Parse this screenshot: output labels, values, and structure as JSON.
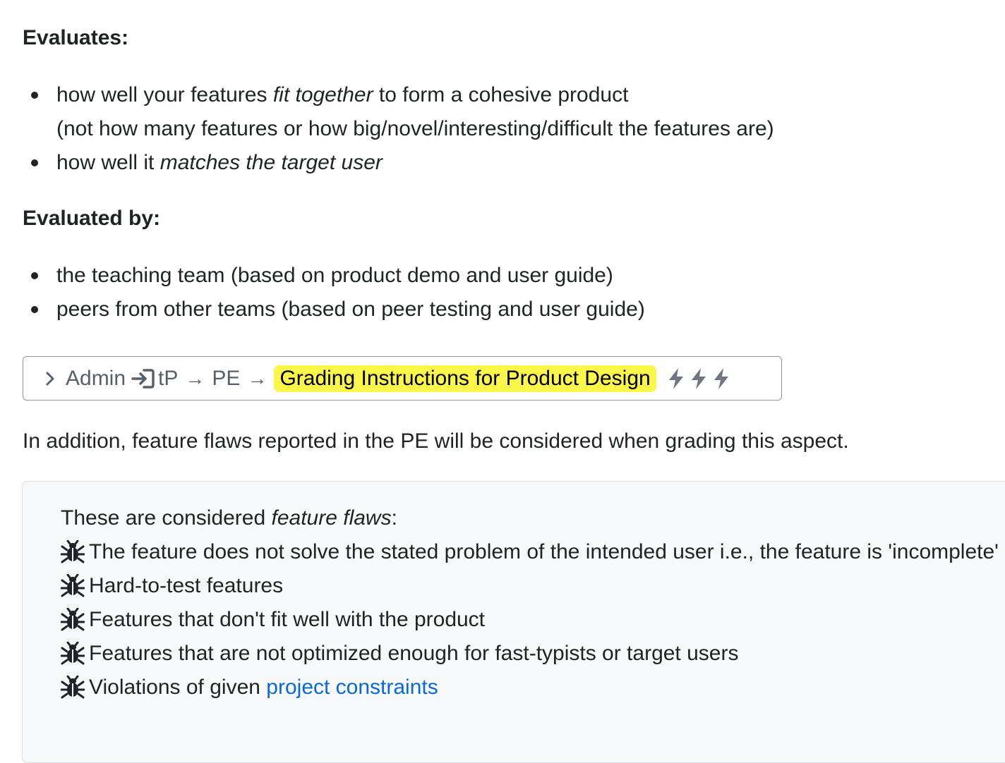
{
  "sections": {
    "evaluates": {
      "heading": "Evaluates:",
      "item1": {
        "pre": "how well your features ",
        "em": "fit together",
        "post": " to form a cohesive product",
        "line2": "(not how many features or how big/novel/interesting/difficult the features are)"
      },
      "item2": {
        "pre": "how well it ",
        "em": "matches the target user"
      }
    },
    "evaluated_by": {
      "heading": "Evaluated by:",
      "items": [
        "the teaching team (based on product demo and user guide)",
        "peers from other teams (based on peer testing and user guide)"
      ]
    }
  },
  "breadcrumb": {
    "chevron_icon": "chevron-right-icon",
    "admin": "Admin",
    "login_icon": "sign-in-icon",
    "tp": "tP",
    "arrow": "→",
    "pe": "PE",
    "current": "Grading Instructions for Product Design",
    "highlight_color": "#fbf64a",
    "bolt_icons": [
      "bolt-icon",
      "bolt-icon",
      "bolt-icon"
    ]
  },
  "paragraph": "In addition, feature flaws reported in the PE will be considered when grading this aspect.",
  "flaws": {
    "intro_pre": "These are considered ",
    "intro_em": "feature flaws",
    "intro_post": ":",
    "bug_icon": "bug-icon",
    "items": [
      "The feature does not solve the stated problem of the intended user i.e., the feature is 'incomplete'",
      "Hard-to-test features",
      "Features that don't fit well with the product",
      "Features that are not optimized enough for fast-typists or target users"
    ],
    "last_pre": "Violations of given ",
    "last_link": "project constraints",
    "link_color": "#0969da"
  }
}
